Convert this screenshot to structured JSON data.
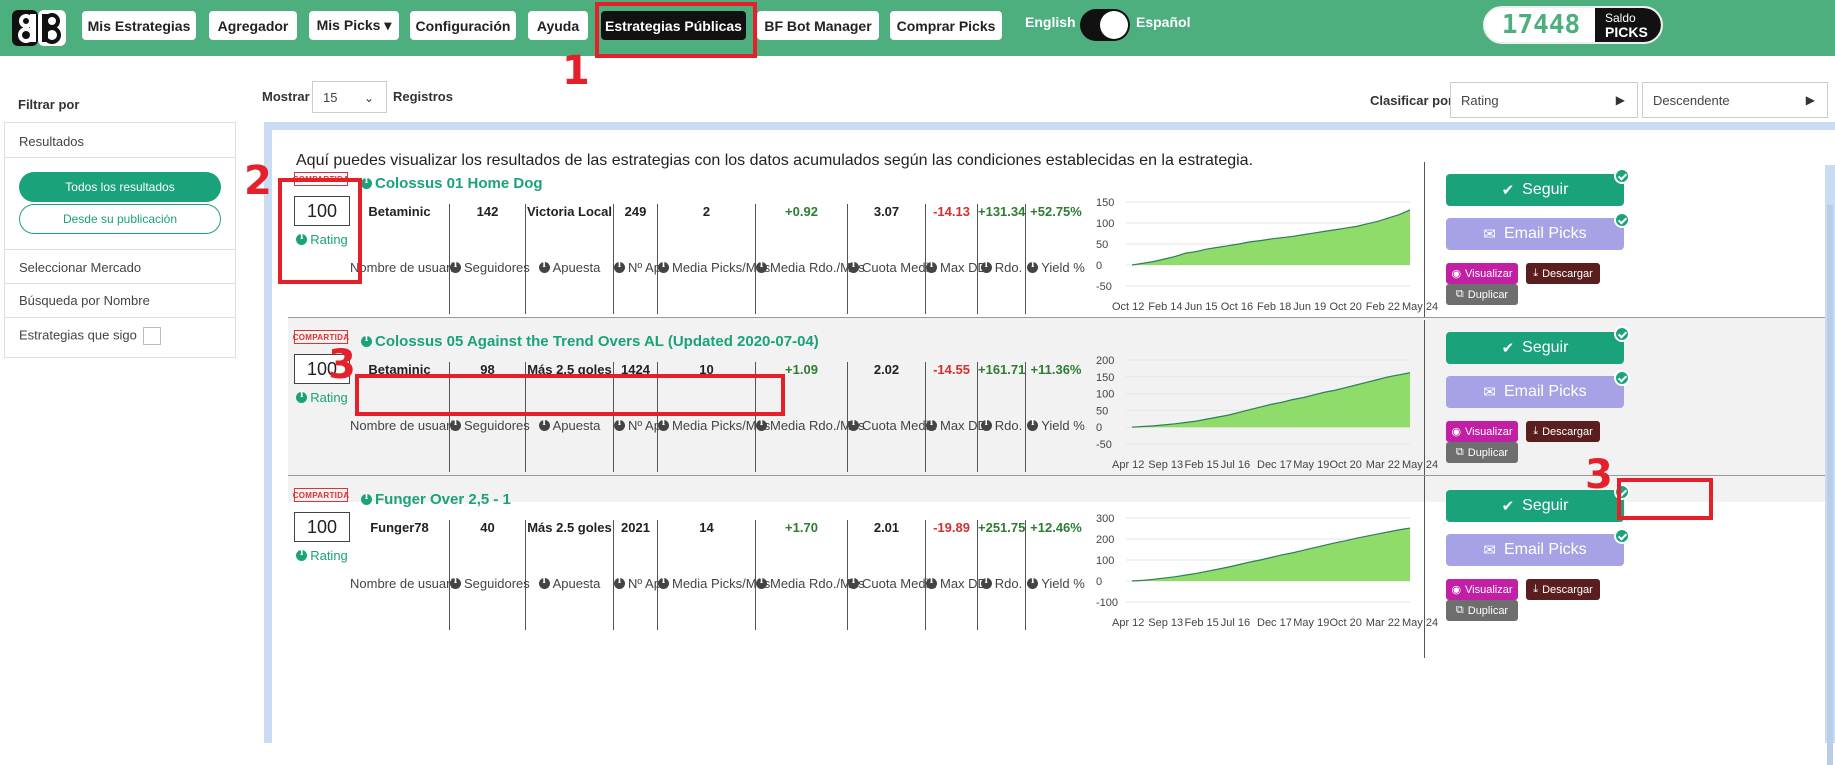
{
  "nav": {
    "items": [
      {
        "label": "Mis Estrategias"
      },
      {
        "label": "Agregador"
      },
      {
        "label": "Mis Picks ▾"
      },
      {
        "label": "Configuración"
      },
      {
        "label": "Ayuda"
      },
      {
        "label": "Estrategias Públicas"
      },
      {
        "label": "BF Bot Manager"
      },
      {
        "label": "Comprar Picks"
      }
    ],
    "lang_left": "English",
    "lang_right": "Español",
    "saldo_value": "17448",
    "saldo_label_top": "Saldo",
    "saldo_label_bottom": "PICKS"
  },
  "annotations": {
    "n1": "1",
    "n2": "2",
    "n3a": "3",
    "n3b": "3"
  },
  "sidebar": {
    "title": "Filtrar por",
    "results_label": "Resultados",
    "all_results": "Todos los resultados",
    "since_pub": "Desde su publicación",
    "market": "Seleccionar Mercado",
    "search_name": "Búsqueda por Nombre",
    "following": "Estrategias que sigo"
  },
  "controls": {
    "show_label": "Mostrar",
    "show_value": "15",
    "records_label": "Registros",
    "sort_label": "Clasificar por",
    "sort_value": "Rating",
    "order_value": "Descendente"
  },
  "intro": "Aquí puedes visualizar los resultados de las estrategias con los datos acumulados según las condiciones establecidas en la estrategia.",
  "labels": {
    "stamp": "COMPARTIDA",
    "rating": "Rating",
    "username": "Nombre de usuario",
    "followers": "Seguidores",
    "bet": "Apuesta",
    "n_ap": "Nº Ap",
    "avg_picks": "Media Picks/Mes",
    "avg_rdo": "Media Rdo./Mes",
    "avg_odds": "Cuota Media",
    "max_dd": "Max DD",
    "rdo": "Rdo.",
    "yield": "Yield %",
    "follow_btn": "Seguir",
    "email_btn": "Email Picks",
    "view_btn": "Visualizar",
    "download_btn": "Descargar",
    "duplicate_btn": "Duplicar"
  },
  "strategies": [
    {
      "name": "Colossus 01 Home Dog",
      "rating": "100",
      "user": "Betaminic",
      "followers": "142",
      "bet": "Victoria Local",
      "n_ap": "249",
      "avg_picks": "2",
      "avg_rdo": "+0.92",
      "avg_odds": "3.07",
      "max_dd": "-14.13",
      "rdo": "+131.34",
      "yield": "+52.75%",
      "chart": {
        "y_ticks": [
          "150",
          "100",
          "50",
          "0",
          "-50"
        ],
        "x_ticks": [
          "Oct 12",
          "Feb 14",
          "Jun 15",
          "Oct 16",
          "Feb 18",
          "Jun 19",
          "Oct 20",
          "Feb 22",
          "May 24"
        ],
        "ymin": -50,
        "ymax": 150,
        "values": [
          0,
          4,
          8,
          14,
          20,
          28,
          32,
          38,
          42,
          46,
          50,
          55,
          58,
          62,
          65,
          68,
          72,
          76,
          80,
          84,
          88,
          92,
          98,
          104,
          112,
          120,
          131
        ]
      }
    },
    {
      "name": "Colossus 05 Against the Trend Overs AL (Updated 2020-07-04)",
      "rating": "100",
      "user": "Betaminic",
      "followers": "98",
      "bet": "Más 2.5 goles",
      "n_ap": "1424",
      "avg_picks": "10",
      "avg_rdo": "+1.09",
      "avg_odds": "2.02",
      "max_dd": "-14.55",
      "rdo": "+161.71",
      "yield": "+11.36%",
      "chart": {
        "y_ticks": [
          "200",
          "150",
          "100",
          "50",
          "0",
          "-50"
        ],
        "x_ticks": [
          "Apr 12",
          "Sep 13",
          "Feb 15",
          "Jul 16",
          "Dec 17",
          "May 19",
          "Oct 20",
          "Mar 22",
          "May 24"
        ],
        "ymin": -50,
        "ymax": 200,
        "values": [
          0,
          2,
          4,
          7,
          10,
          14,
          18,
          24,
          30,
          36,
          44,
          52,
          60,
          68,
          74,
          82,
          88,
          96,
          104,
          110,
          118,
          126,
          134,
          142,
          150,
          156,
          162
        ]
      }
    },
    {
      "name": "Funger Over 2,5 - 1",
      "rating": "100",
      "user": "Funger78",
      "followers": "40",
      "bet": "Más 2.5 goles",
      "n_ap": "2021",
      "avg_picks": "14",
      "avg_rdo": "+1.70",
      "avg_odds": "2.01",
      "max_dd": "-19.89",
      "rdo": "+251.75",
      "yield": "+12.46%",
      "chart": {
        "y_ticks": [
          "300",
          "200",
          "100",
          "0",
          "-100"
        ],
        "x_ticks": [
          "Apr 12",
          "Sep 13",
          "Feb 15",
          "Jul 16",
          "Dec 17",
          "May 19",
          "Oct 20",
          "Mar 22",
          "May 24"
        ],
        "ymin": -100,
        "ymax": 300,
        "values": [
          0,
          3,
          8,
          14,
          20,
          28,
          36,
          46,
          56,
          66,
          78,
          90,
          100,
          112,
          124,
          134,
          146,
          158,
          170,
          182,
          192,
          204,
          214,
          224,
          234,
          244,
          252
        ]
      }
    }
  ]
}
